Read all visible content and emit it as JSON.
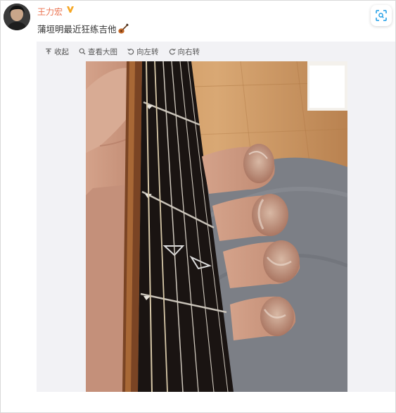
{
  "post": {
    "username": "王力宏",
    "text": "蒲垣明最近狂练吉他"
  },
  "icons": {
    "verified": "verified-v-badge-icon",
    "emoji": "guitar-emoji-icon",
    "scan": "image-scan-icon",
    "collapse": "collapse-up-icon",
    "zoom": "magnifier-icon",
    "rotate_left": "rotate-left-icon",
    "rotate_right": "rotate-right-icon"
  },
  "colors": {
    "username": "#eb7350",
    "verified": "#f5a623",
    "panel_bg": "#f2f2f5",
    "scan_icon": "#1a9be6"
  },
  "toolbar": {
    "collapse_label": "收起",
    "view_large_label": "查看大图",
    "rotate_left_label": "向左转",
    "rotate_right_label": "向右转"
  }
}
